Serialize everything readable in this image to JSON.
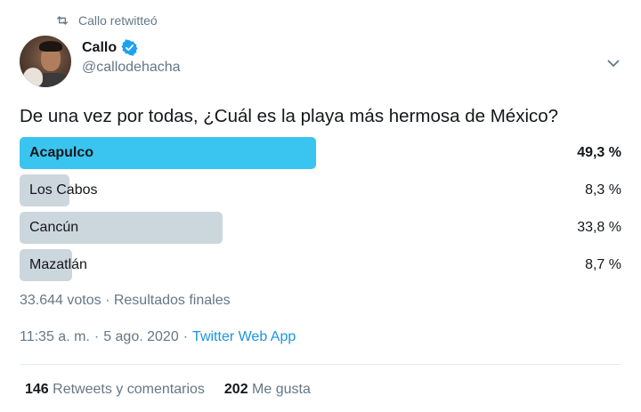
{
  "retweet": {
    "label": "Callo retwitteó",
    "icon": "retweet-icon"
  },
  "author": {
    "display_name": "Callo",
    "handle": "@callodehacha",
    "verified": true,
    "avatar_icon": "avatar"
  },
  "tweet": {
    "question": "De una vez por todas, ¿Cuál es la playa más hermosa de México?"
  },
  "poll": {
    "options": [
      {
        "label": "Acapulco",
        "percent_text": "49,3 %",
        "percent": 49.3,
        "winner": true
      },
      {
        "label": "Los Cabos",
        "percent_text": "8,3 %",
        "percent": 8.3,
        "winner": false
      },
      {
        "label": "Cancún",
        "percent_text": "33,8 %",
        "percent": 33.8,
        "winner": false
      },
      {
        "label": "Mazatlán",
        "percent_text": "8,7 %",
        "percent": 8.7,
        "winner": false
      }
    ],
    "summary": "33.644 votos · Resultados finales"
  },
  "meta": {
    "time": "11:35 a. m.",
    "sep1": "·",
    "date": "5 ago. 2020",
    "sep2": "·",
    "app": "Twitter Web App"
  },
  "stats": {
    "retweets_count": "146",
    "retweets_label": "Retweets y comentarios",
    "likes_count": "202",
    "likes_label": "Me gusta"
  },
  "colors": {
    "winner_bar": "#3ac5f0",
    "other_bar": "#ccd6dd",
    "secondary_text": "#657786",
    "link": "#1b95e0",
    "verified": "#1da1f2"
  }
}
